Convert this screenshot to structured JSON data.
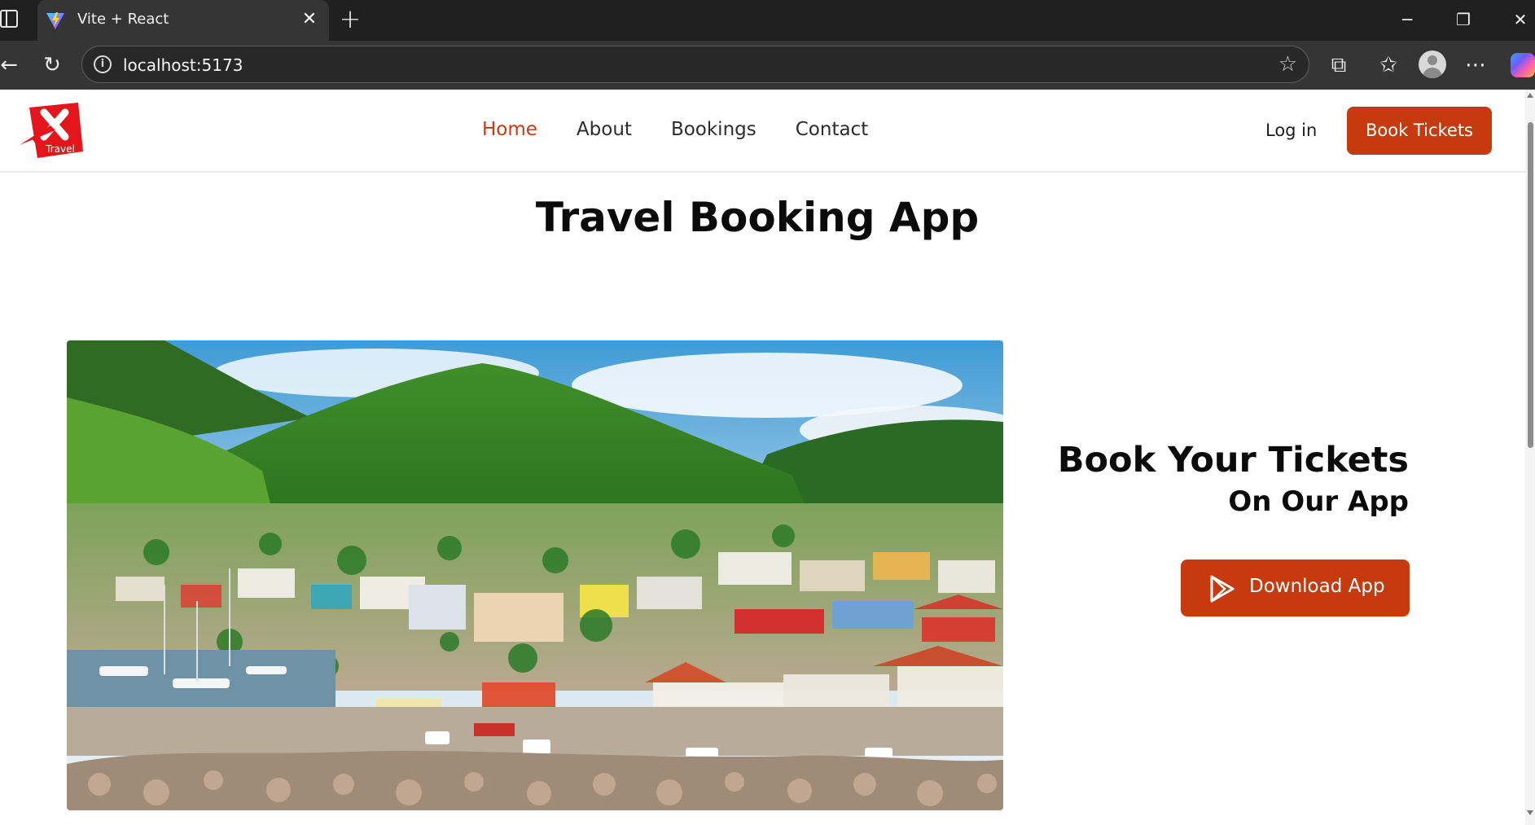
{
  "browser": {
    "tab_title": "Vite + React",
    "url": "localhost:5173",
    "icons": {
      "sidebar": "sidebar-toggle-icon",
      "favicon": "vite-logo-icon",
      "close": "close-icon",
      "new_tab": "plus-icon",
      "back": "arrow-left-icon",
      "reload": "reload-icon",
      "info": "info-icon",
      "bookmark": "star-icon",
      "extensions": "puzzle-icon",
      "favorites": "favorites-icon",
      "profile": "avatar-icon",
      "menu": "ellipsis-icon",
      "copilot": "copilot-icon"
    }
  },
  "navbar": {
    "logo_text": "Travel",
    "links": [
      {
        "label": "Home",
        "active": true
      },
      {
        "label": "About",
        "active": false
      },
      {
        "label": "Bookings",
        "active": false
      },
      {
        "label": "Contact",
        "active": false
      }
    ],
    "login_label": "Log in",
    "book_label": "Book Tickets"
  },
  "main": {
    "title": "Travel Booking App",
    "promo_title": "Book Your Tickets",
    "promo_subtitle": "On Our App",
    "download_label": "Download App"
  },
  "colors": {
    "accent": "#c63a0e",
    "active_link": "#c93a11",
    "chrome_bg": "#202020",
    "toolbar_bg": "#353535"
  }
}
